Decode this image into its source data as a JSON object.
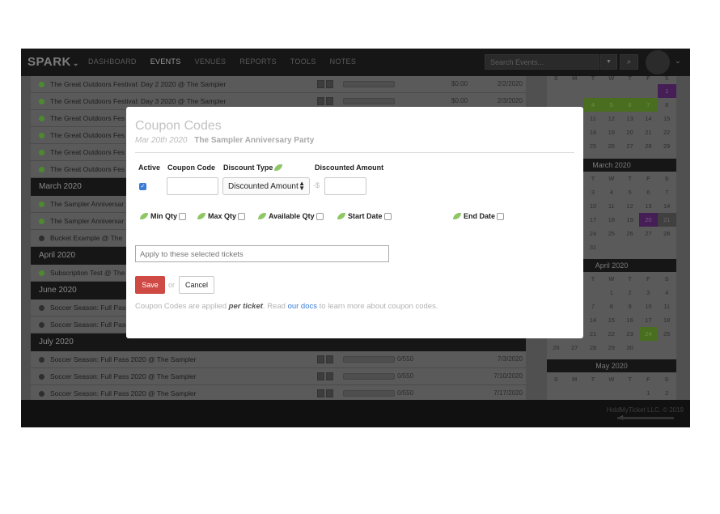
{
  "nav": {
    "brand": "SPARK",
    "links": [
      "DASHBOARD",
      "EVENTS",
      "VENUES",
      "REPORTS",
      "TOOLS",
      "NOTES"
    ],
    "active": "EVENTS",
    "search_placeholder": "Search Events..."
  },
  "events": [
    {
      "name": "The Great Outdoors Festival: Day 2 2020 @ The Sampler",
      "status": "green",
      "price": "$0.00",
      "date": "2/2/2020"
    },
    {
      "name": "The Great Outdoors Festival: Day 3 2020 @ The Sampler",
      "status": "green",
      "price": "$0.00",
      "date": "2/3/2020"
    },
    {
      "name": "The Great Outdoors Fes",
      "status": "green"
    },
    {
      "name": "The Great Outdoors Fes",
      "status": "green"
    },
    {
      "name": "The Great Outdoors Fes",
      "status": "green"
    },
    {
      "name": "The Great Outdoors Fes",
      "status": "green"
    }
  ],
  "months": {
    "march": "March 2020",
    "april": "April 2020",
    "june": "June 2020",
    "july": "July 2020"
  },
  "march_events": [
    {
      "name": "The Sampler Anniversar",
      "status": "green"
    },
    {
      "name": "The Sampler Anniversar",
      "status": "green"
    },
    {
      "name": "Bucket Example @ The",
      "status": "grey"
    }
  ],
  "april_events": [
    {
      "name": "Subscription Test @ The",
      "status": "green"
    }
  ],
  "june_events": [
    {
      "name": "Soccer Season: Full Pass",
      "status": "grey"
    },
    {
      "name": "Soccer Season: Full Pass",
      "status": "grey"
    }
  ],
  "july_events": [
    {
      "name": "Soccer Season: Full Pass 2020 @ The Sampler",
      "status": "grey",
      "sold": "0/550",
      "date": "7/3/2020"
    },
    {
      "name": "Soccer Season: Full Pass 2020 @ The Sampler",
      "status": "grey",
      "sold": "0/550",
      "date": "7/10/2020"
    },
    {
      "name": "Soccer Season: Full Pass 2020 @ The Sampler",
      "status": "grey",
      "sold": "0/550",
      "date": "7/17/2020"
    }
  ],
  "calendar": {
    "weekdays": [
      "S",
      "M",
      "T",
      "W",
      "T",
      "F",
      "S"
    ],
    "feb_rows": [
      [
        "",
        "",
        "",
        "",
        "",
        "",
        "1"
      ],
      [
        "",
        "",
        "4",
        "5",
        "6",
        "7",
        "8"
      ],
      [
        "",
        "",
        "11",
        "12",
        "13",
        "14",
        "15"
      ],
      [
        "",
        "",
        "18",
        "19",
        "20",
        "21",
        "22"
      ],
      [
        "",
        "",
        "25",
        "26",
        "27",
        "28",
        "29"
      ]
    ],
    "march_title": "March 2020",
    "march_rows": [
      [
        "",
        "",
        "3",
        "4",
        "5",
        "6",
        "7"
      ],
      [
        "",
        "",
        "10",
        "11",
        "12",
        "13",
        "14"
      ],
      [
        "",
        "",
        "17",
        "18",
        "19",
        "20",
        "21"
      ],
      [
        "",
        "",
        "24",
        "25",
        "26",
        "27",
        "28"
      ],
      [
        "",
        "",
        "31",
        "",
        "",
        "",
        ""
      ]
    ],
    "april_title": "April 2020",
    "april_rows": [
      [
        "",
        "",
        "",
        "1",
        "2",
        "3",
        "4"
      ],
      [
        "",
        "",
        "7",
        "8",
        "9",
        "10",
        "11"
      ],
      [
        "",
        "",
        "14",
        "15",
        "16",
        "17",
        "18"
      ],
      [
        "",
        "",
        "21",
        "22",
        "23",
        "24",
        "25"
      ],
      [
        "26",
        "27",
        "28",
        "29",
        "30",
        "",
        ""
      ]
    ],
    "may_title": "May 2020",
    "may_rows": [
      [
        "",
        "",
        "",
        "",
        "",
        "1",
        "2"
      ]
    ]
  },
  "footer": {
    "copyright": "HoldMyTicket LLC. © 2019"
  },
  "modal": {
    "title": "Coupon Codes",
    "event_date": "Mar 20th 2020",
    "event_name": "The Sampler Anniversary Party",
    "col_active": "Active",
    "col_code": "Coupon Code",
    "col_type": "Discount Type",
    "col_amount": "Discounted Amount",
    "type_value": "Discounted Amount",
    "dollar": "-$",
    "min_qty": "Min Qty",
    "max_qty": "Max Qty",
    "available_qty": "Available Qty",
    "start_date": "Start Date",
    "end_date": "End Date",
    "tickets_placeholder": "Apply to these selected tickets",
    "save": "Save",
    "or": "or",
    "cancel": "Cancel",
    "note_1": "Coupon Codes are applied ",
    "note_bold": "per ticket",
    "note_2": ". Read ",
    "note_link": "our docs",
    "note_3": " to learn more about coupon codes."
  }
}
